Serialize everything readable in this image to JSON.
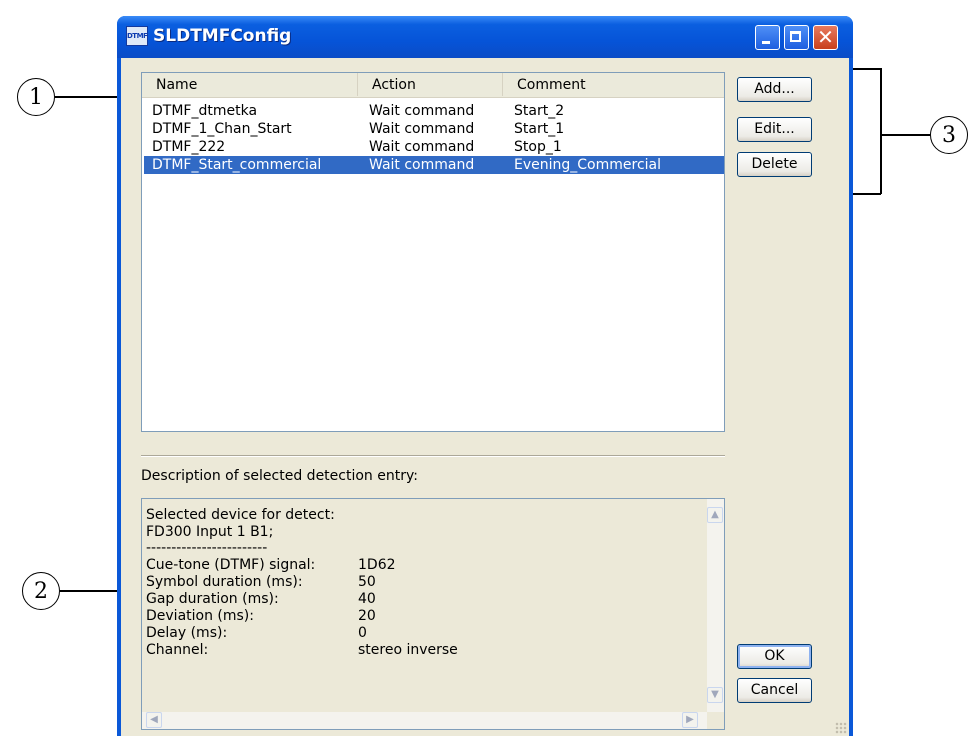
{
  "window": {
    "title": "SLDTMFConfig",
    "icon_label": "DTMF"
  },
  "list": {
    "columns": [
      "Name",
      "Action",
      "Comment"
    ],
    "rows": [
      {
        "name": "DTMF_dtmetka",
        "action": "Wait command",
        "comment": "Start_2"
      },
      {
        "name": "DTMF_1_Chan_Start",
        "action": "Wait command",
        "comment": "Start_1"
      },
      {
        "name": "DTMF_222",
        "action": "Wait command",
        "comment": "Stop_1"
      },
      {
        "name": "DTMF_Start_commercial",
        "action": "Wait command",
        "comment": "Evening_Commercial"
      }
    ],
    "selected_index": 3
  },
  "description": {
    "label": "Description of selected detection entry:",
    "header_lines": [
      "Selected device for detect:",
      "FD300 Input 1 B1;",
      "------------------------"
    ],
    "fields": [
      {
        "label": "Cue-tone (DTMF) signal:",
        "value": "1D62"
      },
      {
        "label": "Symbol duration (ms):",
        "value": "50"
      },
      {
        "label": "Gap duration (ms):",
        "value": "40"
      },
      {
        "label": "Deviation (ms):",
        "value": "20"
      },
      {
        "label": "Delay (ms):",
        "value": "0"
      },
      {
        "label": "Channel:",
        "value": "stereo inverse"
      }
    ]
  },
  "buttons": {
    "add": "Add...",
    "edit": "Edit...",
    "delete": "Delete",
    "ok": "OK",
    "cancel": "Cancel"
  },
  "callouts": [
    "1",
    "2",
    "3"
  ],
  "colors": {
    "titlebar": "#0654d8",
    "selection": "#316ac5",
    "client": "#ece9d8"
  }
}
